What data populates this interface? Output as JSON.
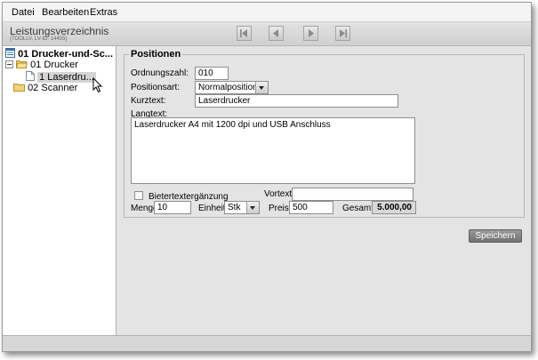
{
  "menu": {
    "datei": "Datei",
    "bearbeiten": "Bearbeiten",
    "extras": "Extras"
  },
  "header": {
    "title": "Leistungsverzeichnis",
    "subtitle": "(TOOLLV, LV-ID: 14455)"
  },
  "tree": {
    "root": "01 Drucker-und-Sc...",
    "folder1": "01 Drucker",
    "item1": "1 Laserdru...",
    "folder2": "02 Scanner"
  },
  "positionen": {
    "legend": "Positionen",
    "ordnungszahl_label": "Ordnungszahl:",
    "ordnungszahl_value": "010",
    "positionsart_label": "Positionsart:",
    "positionsart_value": "Normalposition.",
    "kurztext_label": "Kurztext:",
    "kurztext_value": "Laserdrucker",
    "langtext_label": "Langtext:",
    "langtext_value": "Laserdrucker A4 mit 1200 dpi und USB Anschluss",
    "bietertext_label": "Bietertextergänzung",
    "vortext_label": "Vortext:",
    "vortext_value": "",
    "menge_label": "Menge",
    "menge_value": "10",
    "einheit_label": "Einheit",
    "einheit_value": "Stk",
    "preis_label": "Preis",
    "preis_value": "500",
    "gesamt_label": "Gesamt:",
    "gesamt_value": "5.000,00"
  },
  "buttons": {
    "save": "Speichern"
  },
  "icons": {
    "first": "first-page-icon",
    "prev": "prev-page-icon",
    "next": "next-page-icon",
    "last": "last-page-icon"
  }
}
